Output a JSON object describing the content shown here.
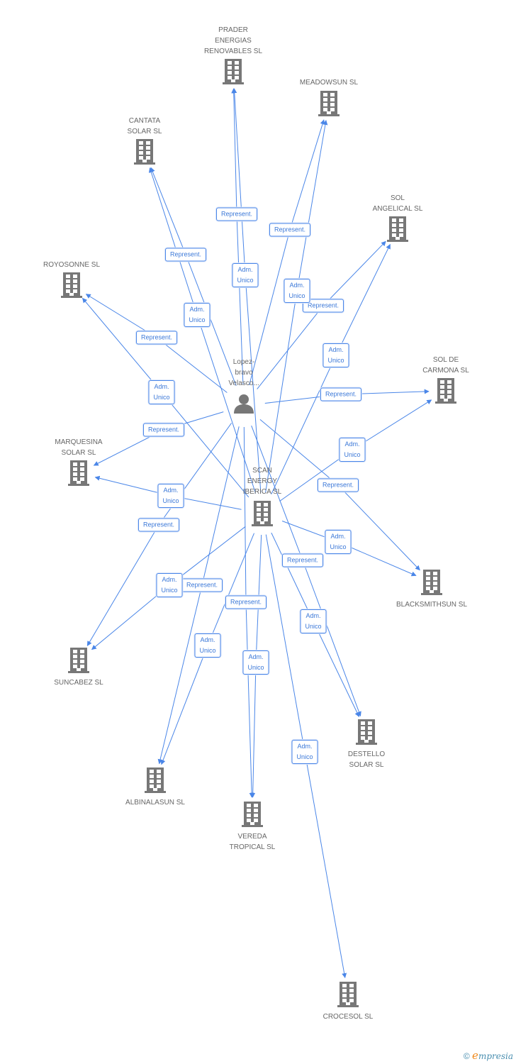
{
  "colors": {
    "edge": "#4a86e8",
    "icon": "#777777",
    "label_text": "#666666"
  },
  "nodes": [
    {
      "id": "person",
      "type": "person",
      "label": "Lopez-\nbravo\nVelasco..."
    },
    {
      "id": "scan",
      "type": "company",
      "label": "SCAN\nENERGY\nIBERICA SL"
    },
    {
      "id": "prader",
      "type": "company",
      "label": "PRADER\nENERGIAS\nRENOVABLES SL"
    },
    {
      "id": "meadowsun",
      "type": "company",
      "label": "MEADOWSUN SL"
    },
    {
      "id": "cantata",
      "type": "company",
      "label": "CANTATA\nSOLAR SL"
    },
    {
      "id": "angelical",
      "type": "company",
      "label": "SOL\nANGELICAL SL"
    },
    {
      "id": "royosonne",
      "type": "company",
      "label": "ROYOSONNE SL"
    },
    {
      "id": "carmona",
      "type": "company",
      "label": "SOL DE\nCARMONA SL"
    },
    {
      "id": "marquesina",
      "type": "company",
      "label": "MARQUESINA\nSOLAR SL"
    },
    {
      "id": "blacksmithsun",
      "type": "company",
      "label": "BLACKSMITHSUN SL"
    },
    {
      "id": "suncabez",
      "type": "company",
      "label": "SUNCABEZ SL"
    },
    {
      "id": "destello",
      "type": "company",
      "label": "DESTELLO\nSOLAR SL"
    },
    {
      "id": "albinalasun",
      "type": "company",
      "label": "ALBINALASUN SL"
    },
    {
      "id": "vereda",
      "type": "company",
      "label": "VEREDA\nTROPICAL SL"
    },
    {
      "id": "crocesol",
      "type": "company",
      "label": "CROCESOL SL"
    }
  ],
  "edges": [
    {
      "from": "person",
      "to": "prader",
      "label": "Represent."
    },
    {
      "from": "person",
      "to": "meadowsun",
      "label": "Represent."
    },
    {
      "from": "person",
      "to": "cantata",
      "label": "Represent."
    },
    {
      "from": "person",
      "to": "angelical",
      "label": "Represent."
    },
    {
      "from": "person",
      "to": "royosonne",
      "label": "Represent."
    },
    {
      "from": "person",
      "to": "carmona",
      "label": "Represent."
    },
    {
      "from": "person",
      "to": "marquesina",
      "label": "Represent."
    },
    {
      "from": "person",
      "to": "blacksmithsun",
      "label": "Represent."
    },
    {
      "from": "person",
      "to": "suncabez",
      "label": "Represent."
    },
    {
      "from": "person",
      "to": "destello",
      "label": "Represent."
    },
    {
      "from": "person",
      "to": "albinalasun",
      "label": "Represent."
    },
    {
      "from": "person",
      "to": "vereda",
      "label": "Represent."
    },
    {
      "from": "scan",
      "to": "prader",
      "label": "Adm.\nUnico"
    },
    {
      "from": "scan",
      "to": "meadowsun",
      "label": "Adm.\nUnico"
    },
    {
      "from": "scan",
      "to": "cantata",
      "label": "Adm.\nUnico"
    },
    {
      "from": "scan",
      "to": "angelical",
      "label": "Adm.\nUnico"
    },
    {
      "from": "scan",
      "to": "royosonne",
      "label": "Adm.\nUnico"
    },
    {
      "from": "scan",
      "to": "carmona",
      "label": "Adm.\nUnico"
    },
    {
      "from": "scan",
      "to": "marquesina",
      "label": "Adm.\nUnico"
    },
    {
      "from": "scan",
      "to": "blacksmithsun",
      "label": "Adm.\nUnico"
    },
    {
      "from": "scan",
      "to": "suncabez",
      "label": "Adm.\nUnico"
    },
    {
      "from": "scan",
      "to": "destello",
      "label": "Adm.\nUnico"
    },
    {
      "from": "scan",
      "to": "albinalasun",
      "label": "Adm.\nUnico"
    },
    {
      "from": "scan",
      "to": "vereda",
      "label": "Adm.\nUnico"
    },
    {
      "from": "scan",
      "to": "crocesol",
      "label": "Adm.\nUnico"
    }
  ],
  "footer": {
    "copyright": "©",
    "brand": "Empresia"
  }
}
